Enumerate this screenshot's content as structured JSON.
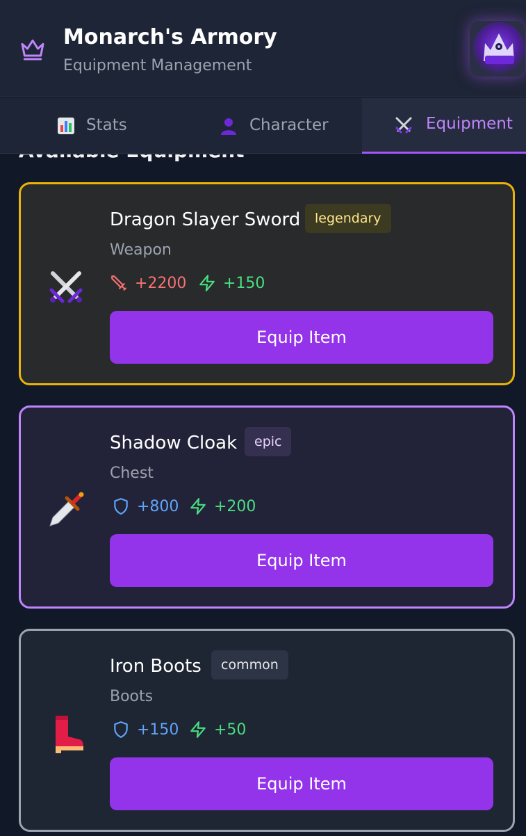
{
  "header": {
    "title": "Monarch's Armory",
    "subtitle": "Equipment Management"
  },
  "tabs": [
    {
      "label": "Stats",
      "icon": "bar-chart-icon"
    },
    {
      "label": "Character",
      "icon": "person-icon"
    },
    {
      "label": "Equipment",
      "icon": "crossed-swords-icon",
      "active": true
    }
  ],
  "section": {
    "title": "Available Equipment"
  },
  "items": [
    {
      "name": "Dragon Slayer Sword",
      "rarity": "legendary",
      "type": "Weapon",
      "icon": "crossed-swords-icon",
      "stats": [
        {
          "icon": "sword-icon",
          "value": "+2200",
          "color": "#f87171"
        },
        {
          "icon": "lightning-icon",
          "value": "+150",
          "color": "#4ade80"
        }
      ],
      "button": "Equip Item"
    },
    {
      "name": "Shadow Cloak",
      "rarity": "epic",
      "type": "Chest",
      "icon": "dagger-icon",
      "stats": [
        {
          "icon": "shield-icon",
          "value": "+800",
          "color": "#60a5fa"
        },
        {
          "icon": "lightning-icon",
          "value": "+200",
          "color": "#4ade80"
        }
      ],
      "button": "Equip Item"
    },
    {
      "name": "Iron Boots",
      "rarity": "common",
      "type": "Boots",
      "icon": "boot-icon",
      "stats": [
        {
          "icon": "shield-icon",
          "value": "+150",
          "color": "#60a5fa"
        },
        {
          "icon": "lightning-icon",
          "value": "+50",
          "color": "#4ade80"
        }
      ],
      "button": "Equip Item"
    }
  ],
  "colors": {
    "accent": "#a855f7",
    "button": "#9333ea",
    "legendary": "#eab308",
    "epic": "#c084fc",
    "common": "#9ca3af"
  }
}
